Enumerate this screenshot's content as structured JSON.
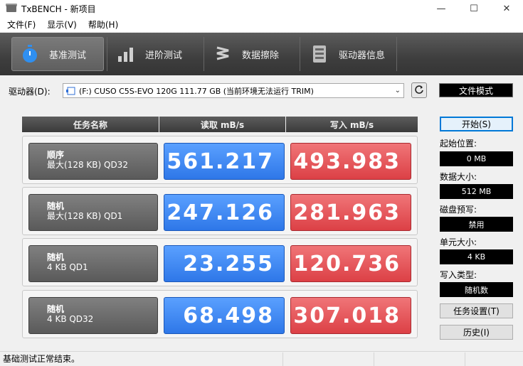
{
  "window": {
    "title": "TxBENCH - 新项目"
  },
  "menu": [
    "文件(F)",
    "显示(V)",
    "帮助(H)"
  ],
  "tabs": [
    {
      "label": "基准测试",
      "icon": "stopwatch-icon"
    },
    {
      "label": "进阶测试",
      "icon": "bar-chart-icon"
    },
    {
      "label": "数据擦除",
      "icon": "erase-icon"
    },
    {
      "label": "驱动器信息",
      "icon": "drive-info-icon"
    }
  ],
  "drive": {
    "label": "驱动器(D):",
    "selected": "(F:) CUSO C5S-EVO 120G  111.77 GB (当前环境无法运行 TRIM)"
  },
  "file_mode_label": "文件模式",
  "table": {
    "headers": [
      "任务名称",
      "读取 mB/s",
      "写入 mB/s"
    ],
    "rows": [
      {
        "name_line1": "顺序",
        "name_line2": "最大(128 KB) QD32",
        "read": "561.217",
        "write": "493.983"
      },
      {
        "name_line1": "随机",
        "name_line2": "最大(128 KB) QD1",
        "read": "247.126",
        "write": "281.963"
      },
      {
        "name_line1": "随机",
        "name_line2": "4 KB QD1",
        "read": "23.255",
        "write": "120.736"
      },
      {
        "name_line1": "随机",
        "name_line2": "4 KB QD32",
        "read": "68.498",
        "write": "307.018"
      }
    ]
  },
  "side": {
    "start_label": "开始(S)",
    "start_pos_label": "起始位置:",
    "start_pos_value": "0 MB",
    "data_size_label": "数据大小:",
    "data_size_value": "512 MB",
    "precondition_label": "磁盘预写:",
    "precondition_value": "禁用",
    "unit_size_label": "单元大小:",
    "unit_size_value": "4 KB",
    "write_type_label": "写入类型:",
    "write_type_value": "随机数",
    "task_settings_label": "任务设置(T)",
    "history_label": "历史(I)"
  },
  "status": {
    "text": "基础测试正常结束。"
  },
  "colors": {
    "read": "#3a86f2",
    "write": "#e5535a",
    "tabbar": "#3e3e3e"
  }
}
